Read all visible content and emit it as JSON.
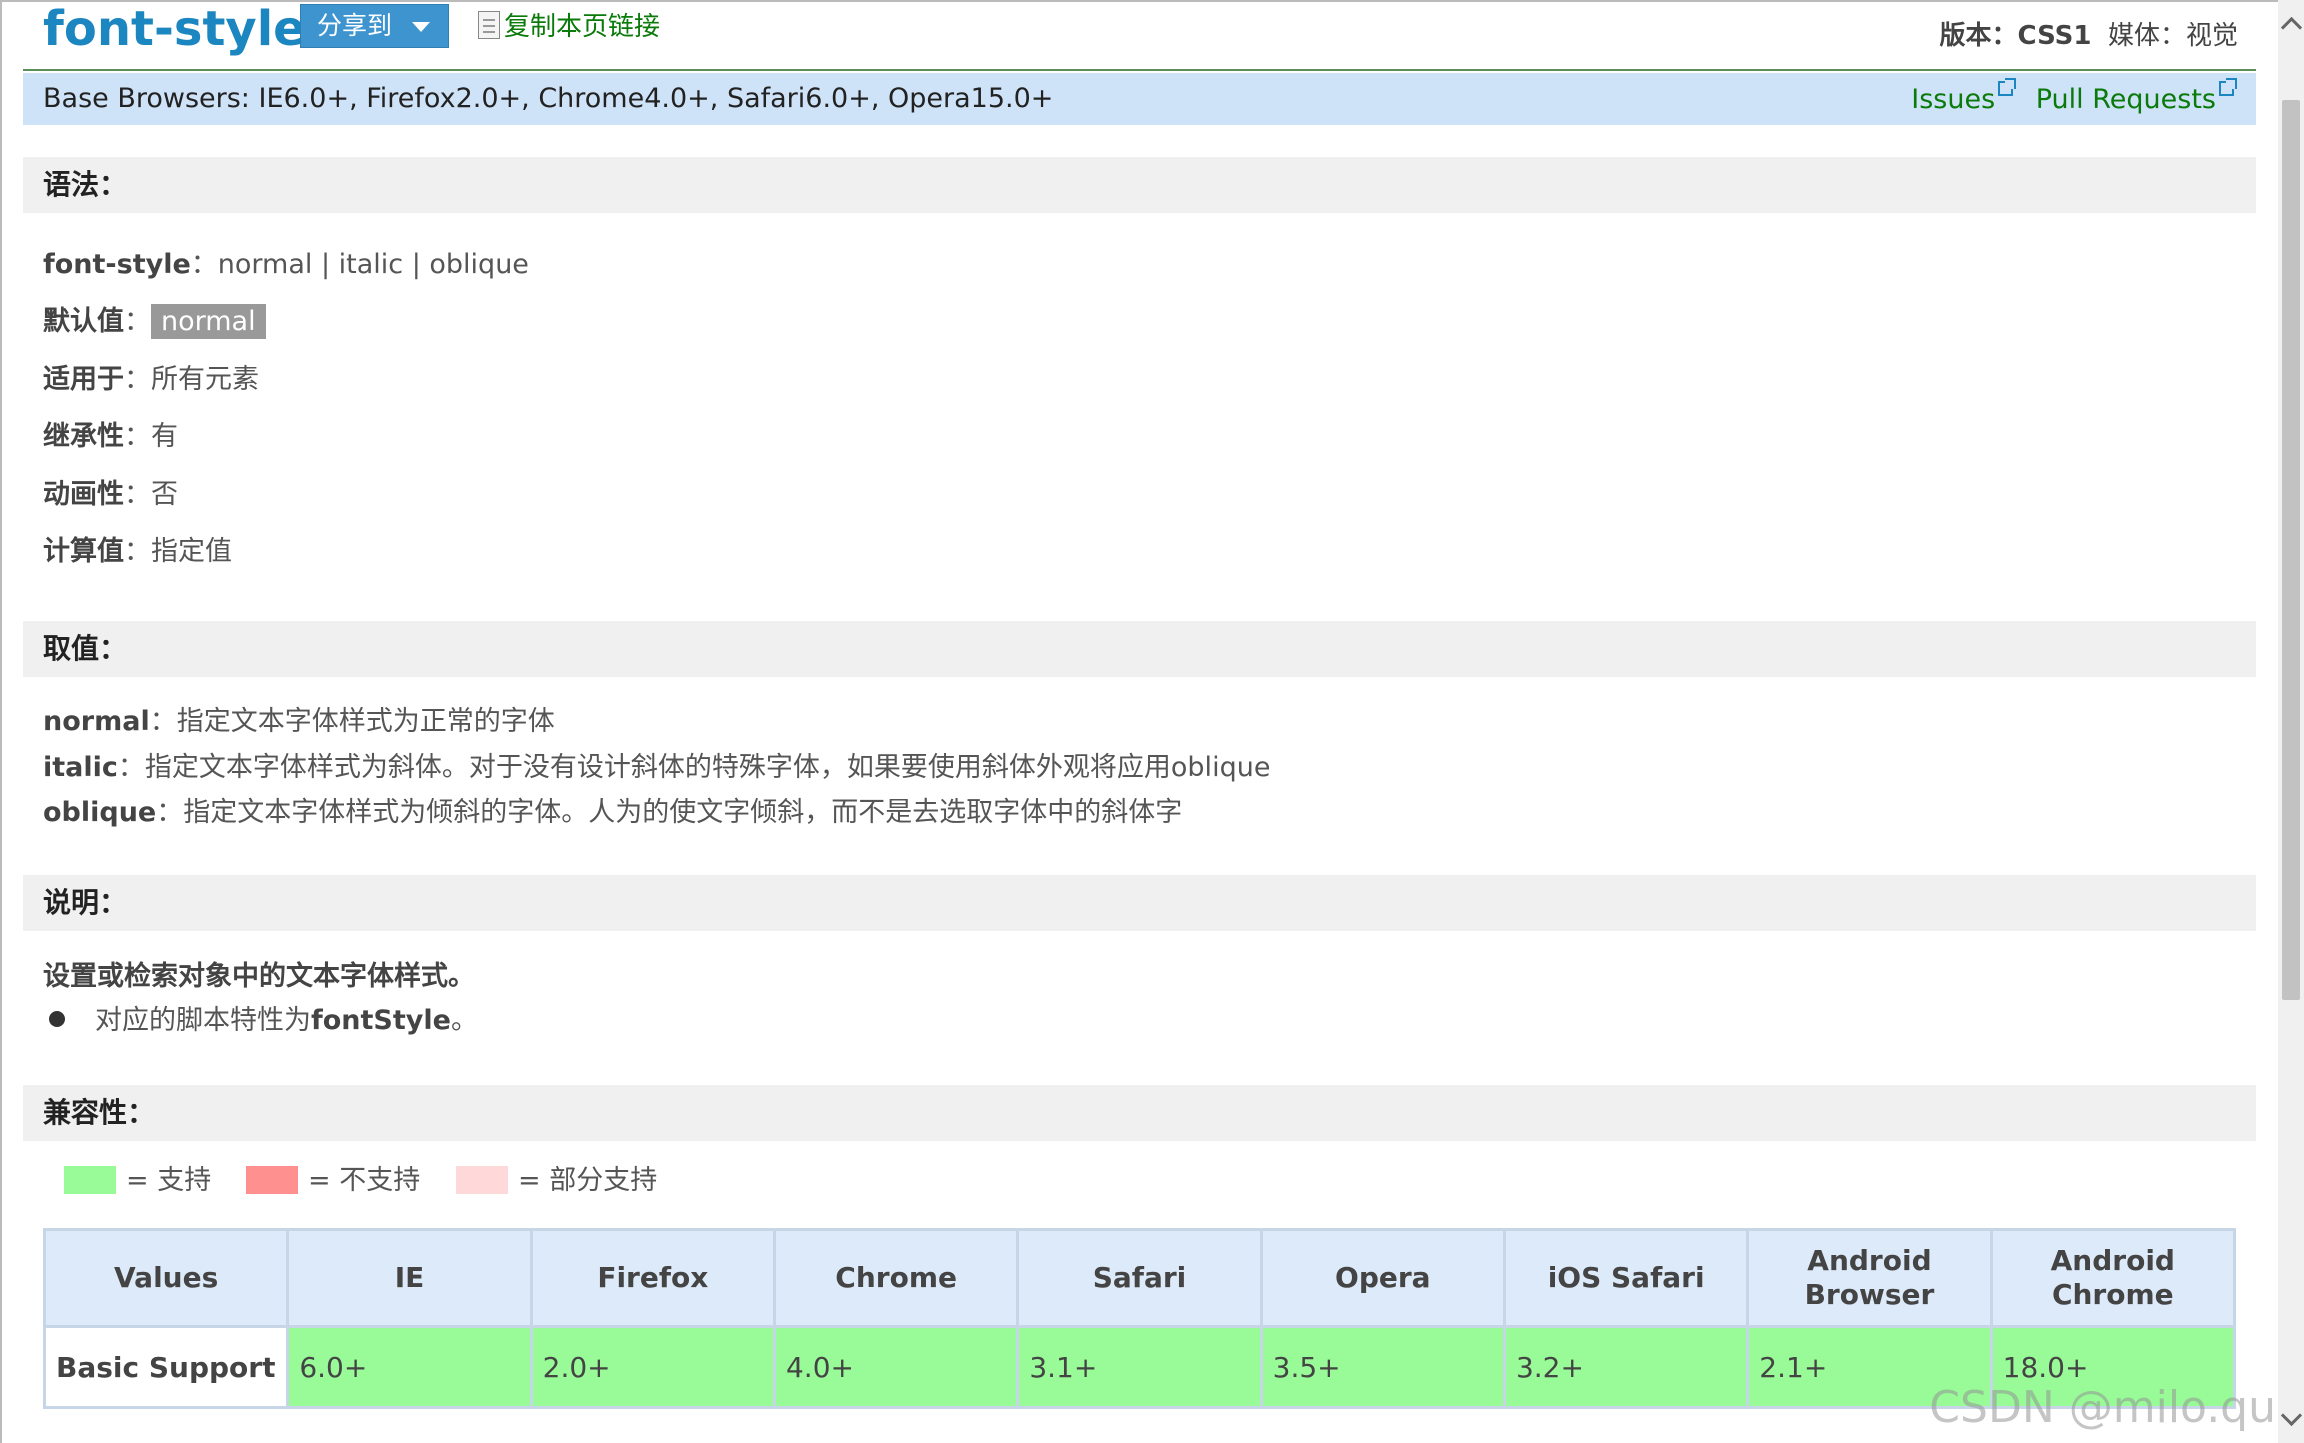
{
  "header": {
    "title": "font-style",
    "share_label": "分享到",
    "copy_link_label": "复制本页链接",
    "version_label": "版本：",
    "version_value": "CSS1",
    "media_label": "媒体：视觉"
  },
  "browsers_bar": {
    "text": "Base Browsers: IE6.0+, Firefox2.0+, Chrome4.0+, Safari6.0+, Opera15.0+",
    "issues_label": "Issues",
    "pull_requests_label": "Pull Requests"
  },
  "syntax": {
    "heading": "语法：",
    "prop_name": "font-style",
    "prop_values": "：normal | italic | oblique",
    "default_key": "默认值",
    "default_value": "normal",
    "applies_key": "适用于",
    "applies_value": "：所有元素",
    "inherit_key": "继承性",
    "inherit_value": "：有",
    "anim_key": "动画性",
    "anim_value": "：否",
    "computed_key": "计算值",
    "computed_value": "：指定值"
  },
  "values": {
    "heading": "取值：",
    "items": [
      {
        "key": "normal",
        "desc": "：指定文本字体样式为正常的字体"
      },
      {
        "key": "italic",
        "desc": "：指定文本字体样式为斜体。对于没有设计斜体的特殊字体，如果要使用斜体外观将应用oblique"
      },
      {
        "key": "oblique",
        "desc": "：指定文本字体样式为倾斜的字体。人为的使文字倾斜，而不是去选取字体中的斜体字"
      }
    ]
  },
  "description": {
    "heading": "说明：",
    "text": "设置或检索对象中的文本字体样式。",
    "bullet_prefix": "对应的脚本特性为",
    "bullet_key": "fontStyle",
    "bullet_suffix": "。"
  },
  "compat": {
    "heading": "兼容性：",
    "legend": [
      {
        "label": "= 支持",
        "color": "#98fb98"
      },
      {
        "label": "= 不支持",
        "color": "#ff9090"
      },
      {
        "label": "= 部分支持",
        "color": "#ffd9d9"
      }
    ],
    "columns": [
      "Values",
      "IE",
      "Firefox",
      "Chrome",
      "Safari",
      "Opera",
      "iOS Safari",
      "Android Browser",
      "Android Chrome"
    ],
    "row_label": "Basic Support",
    "row_values": [
      "6.0+",
      "2.0+",
      "4.0+",
      "3.1+",
      "3.5+",
      "3.2+",
      "2.1+",
      "18.0+"
    ]
  },
  "watermark": "CSDN @milo.qu"
}
